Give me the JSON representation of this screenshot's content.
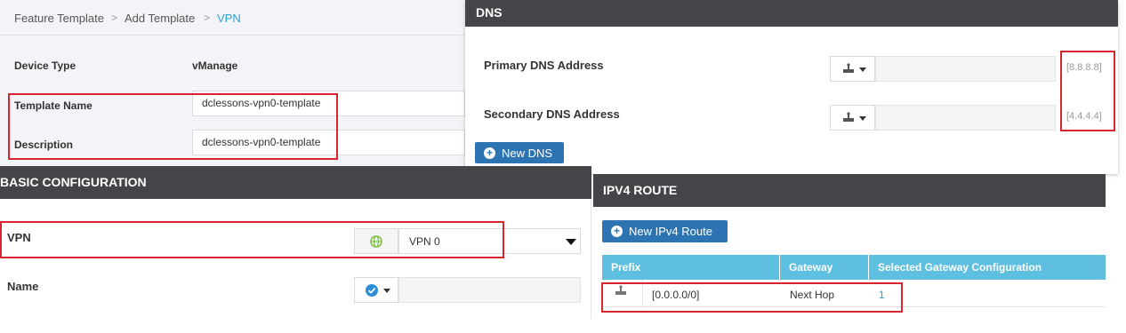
{
  "breadcrumb": {
    "items": [
      "Feature Template",
      "Add Template",
      "VPN"
    ],
    "separator": ">"
  },
  "template": {
    "device_type_label": "Device Type",
    "device_type_value": "vManage",
    "name_label": "Template Name",
    "name_value": "dclessons-vpn0-template",
    "description_label": "Description",
    "description_value": "dclessons-vpn0-template"
  },
  "dns": {
    "title": "DNS",
    "primary_label": "Primary DNS Address",
    "primary_hint": "[8.8.8.8]",
    "secondary_label": "Secondary DNS Address",
    "secondary_hint": "[4.4.4.4]",
    "new_button": "New DNS"
  },
  "basic": {
    "title": "BASIC CONFIGURATION",
    "vpn_label": "VPN",
    "vpn_value": "VPN 0",
    "name_label": "Name"
  },
  "ipv4": {
    "title": "IPV4 ROUTE",
    "new_button": "New IPv4 Route",
    "columns": [
      "Prefix",
      "Gateway",
      "Selected Gateway Configuration"
    ],
    "rows": [
      {
        "prefix": "[0.0.0.0/0]",
        "gateway": "Next Hop",
        "config": "1"
      }
    ]
  },
  "colors": {
    "header_bg": "#444548",
    "accent_blue": "#2d75b2",
    "table_header": "#5ebfe0",
    "highlight": "#d7262f"
  }
}
